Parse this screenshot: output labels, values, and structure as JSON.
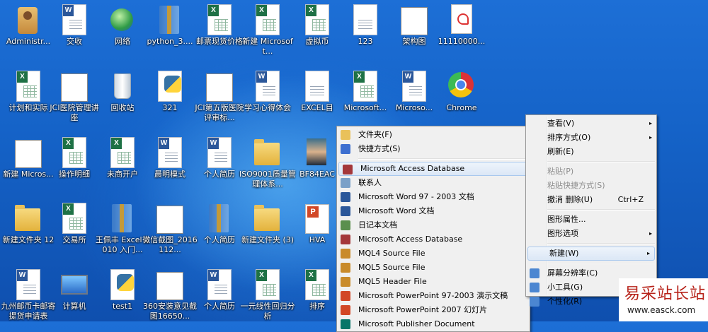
{
  "desktop_icons": [
    {
      "label": "Administr...",
      "type": "user"
    },
    {
      "label": "交收",
      "type": "word"
    },
    {
      "label": "网络",
      "type": "net"
    },
    {
      "label": "python_3....",
      "type": "zip"
    },
    {
      "label": "邮票现货价格",
      "type": "excel"
    },
    {
      "label": "新建 Microsoft...",
      "type": "excel"
    },
    {
      "label": "虚拟币",
      "type": "excel"
    },
    {
      "label": "123",
      "type": "blank"
    },
    {
      "label": "架构图",
      "type": "thumb"
    },
    {
      "label": "11110000...",
      "type": "pdf"
    },
    {
      "label": "计划和实际",
      "type": "excel"
    },
    {
      "label": "JCI医院管理讲座",
      "type": "thumb"
    },
    {
      "label": "回收站",
      "type": "bin"
    },
    {
      "label": "321",
      "type": "py"
    },
    {
      "label": "JCI第五版医院评审标...",
      "type": "thumb"
    },
    {
      "label": "学习心得体会",
      "type": "word"
    },
    {
      "label": "EXCEL目",
      "type": "blank"
    },
    {
      "label": "Microsoft...",
      "type": "excel"
    },
    {
      "label": "Microso...",
      "type": "word"
    },
    {
      "label": "Chrome",
      "type": "chrome"
    },
    {
      "label": "新建 Micros...",
      "type": "thumb"
    },
    {
      "label": "操作明细",
      "type": "excel"
    },
    {
      "label": "未商开户",
      "type": "excel"
    },
    {
      "label": "晨明模式",
      "type": "word"
    },
    {
      "label": "个人简历",
      "type": "word"
    },
    {
      "label": "ISO9001质量管理体系...",
      "type": "folder"
    },
    {
      "label": "BF84EAC",
      "type": "photo"
    },
    {
      "label": "新建文件夹 12",
      "type": "folder"
    },
    {
      "label": "交易所",
      "type": "excel"
    },
    {
      "label": "王佩丰 Excel 2010 入门...",
      "type": "zip"
    },
    {
      "label": "微信截图_2016112...",
      "type": "thumb"
    },
    {
      "label": "个人简历",
      "type": "zip"
    },
    {
      "label": "新建文件夹 (3)",
      "type": "folder"
    },
    {
      "label": "HVA",
      "type": "ppt"
    },
    {
      "label": "九州邮币卡邮寄提货申请表",
      "type": "word"
    },
    {
      "label": "计算机",
      "type": "pc"
    },
    {
      "label": "test1",
      "type": "py"
    },
    {
      "label": "360安装意见截图16650...",
      "type": "thumb"
    },
    {
      "label": "个人简历",
      "type": "word"
    },
    {
      "label": "一元线性回归分析",
      "type": "excel"
    },
    {
      "label": "排序",
      "type": "excel"
    }
  ],
  "context_menu": {
    "items": [
      {
        "label": "查看(V)",
        "arrow": "▸"
      },
      {
        "label": "排序方式(O)",
        "arrow": "▸"
      },
      {
        "label": "刷新(E)"
      },
      {
        "sep": true
      },
      {
        "label": "粘贴(P)",
        "disabled": true
      },
      {
        "label": "粘贴快捷方式(S)",
        "disabled": true
      },
      {
        "label": "撤消 删除(U)",
        "shortcut": "Ctrl+Z"
      },
      {
        "sep": true
      },
      {
        "label": "图形属性..."
      },
      {
        "label": "图形选项",
        "arrow": "▸"
      },
      {
        "sep": true
      },
      {
        "label": "新建(W)",
        "arrow": "▸",
        "selected": true
      },
      {
        "sep": true
      },
      {
        "label": "屏幕分辨率(C)"
      },
      {
        "label": "小工具(G)"
      },
      {
        "label": "个性化(R)"
      }
    ]
  },
  "new_submenu": {
    "items": [
      {
        "label": "文件夹(F)",
        "icon": "folder-icon"
      },
      {
        "label": "快捷方式(S)",
        "icon": "shortcut-icon"
      },
      {
        "sep": true
      },
      {
        "label": "Microsoft Access Database",
        "icon": "access-icon",
        "selected": true
      },
      {
        "label": "联系人",
        "icon": "contact-icon"
      },
      {
        "label": "Microsoft Word 97 - 2003 文档",
        "icon": "word-icon"
      },
      {
        "label": "Microsoft Word 文档",
        "icon": "word-icon"
      },
      {
        "label": "日记本文档",
        "icon": "journal-icon"
      },
      {
        "label": "Microsoft Access Database",
        "icon": "access-icon"
      },
      {
        "label": "MQL4 Source File",
        "icon": "mql-icon"
      },
      {
        "label": "MQL5 Source File",
        "icon": "mql-icon"
      },
      {
        "label": "MQL5 Header File",
        "icon": "mql-icon"
      },
      {
        "label": "Microsoft PowerPoint 97-2003 演示文稿",
        "icon": "ppt-icon"
      },
      {
        "label": "Microsoft PowerPoint 2007 幻灯片",
        "icon": "ppt-icon"
      },
      {
        "label": "Microsoft Publisher Document",
        "icon": "publisher-icon"
      }
    ]
  },
  "watermark": {
    "main": "易采站长站",
    "sub": "www.easck.com"
  },
  "colors": {
    "excel": "#1e7145",
    "word": "#2b579a",
    "ppt": "#d24726",
    "access": "#a4373a"
  }
}
